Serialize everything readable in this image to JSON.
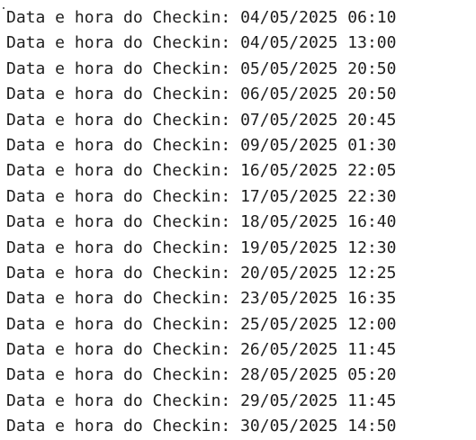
{
  "console": {
    "lines": [
      "Data e hora do Checkin: 04/05/2025 06:10",
      "Data e hora do Checkin: 04/05/2025 13:00",
      "Data e hora do Checkin: 05/05/2025 20:50",
      "Data e hora do Checkin: 06/05/2025 20:50",
      "Data e hora do Checkin: 07/05/2025 20:45",
      "Data e hora do Checkin: 09/05/2025 01:30",
      "Data e hora do Checkin: 16/05/2025 22:05",
      "Data e hora do Checkin: 17/05/2025 22:30",
      "Data e hora do Checkin: 18/05/2025 16:40",
      "Data e hora do Checkin: 19/05/2025 12:30",
      "Data e hora do Checkin: 20/05/2025 12:25",
      "Data e hora do Checkin: 23/05/2025 16:35",
      "Data e hora do Checkin: 25/05/2025 12:00",
      "Data e hora do Checkin: 26/05/2025 11:45",
      "Data e hora do Checkin: 28/05/2025 05:20",
      "Data e hora do Checkin: 29/05/2025 11:45",
      "Data e hora do Checkin: 30/05/2025 14:50"
    ]
  }
}
